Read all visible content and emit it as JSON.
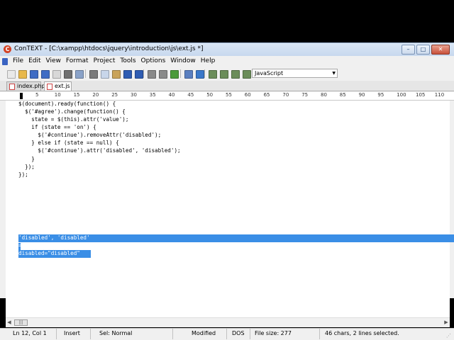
{
  "window": {
    "title": "ConTEXT - [C:\\xampp\\htdocs\\jquery\\introduction\\js\\ext.js *]",
    "controls": {
      "minimize": "–",
      "maximize": "□",
      "close": "✕"
    }
  },
  "menu": [
    "File",
    "Edit",
    "View",
    "Format",
    "Project",
    "Tools",
    "Options",
    "Window",
    "Help"
  ],
  "toolbar": {
    "language": "JavaScript",
    "buttons": [
      {
        "name": "new-icon",
        "color": "#e9e9e9"
      },
      {
        "name": "open-icon",
        "color": "#e8b84a"
      },
      {
        "name": "save-icon",
        "color": "#3f6cc4"
      },
      {
        "name": "save-all-icon",
        "color": "#3f6cc4"
      },
      {
        "name": "close-file-icon",
        "color": "#d8d8d8"
      },
      {
        "name": "print-icon",
        "color": "#707070"
      },
      {
        "name": "print-preview-icon",
        "color": "#8aa2c8"
      },
      {
        "name": "cut-icon",
        "color": "#7a7a7a"
      },
      {
        "name": "copy-icon",
        "color": "#c8d6ea"
      },
      {
        "name": "paste-icon",
        "color": "#c9a35a"
      },
      {
        "name": "undo-icon",
        "color": "#2f5db3"
      },
      {
        "name": "redo-icon",
        "color": "#2f5db3"
      },
      {
        "name": "find-icon",
        "color": "#8a8a8a"
      },
      {
        "name": "find-next-icon",
        "color": "#8a8a8a"
      },
      {
        "name": "replace-icon",
        "color": "#4a9a3a"
      },
      {
        "name": "word-wrap-icon",
        "color": "#5a7fc0"
      },
      {
        "name": "tools-icon",
        "color": "#3a78c9"
      },
      {
        "name": "execute-f9-icon",
        "color": "#6b8d5a"
      },
      {
        "name": "execute-f10-icon",
        "color": "#6b8d5a"
      },
      {
        "name": "execute-f11-icon",
        "color": "#6b8d5a"
      },
      {
        "name": "execute-f12-icon",
        "color": "#6b8d5a"
      }
    ]
  },
  "tabs": [
    {
      "label": "index.php",
      "active": false
    },
    {
      "label": "ext.js *",
      "active": true
    }
  ],
  "ruler": [
    "5",
    "10",
    "15",
    "20",
    "25",
    "30",
    "35",
    "40",
    "45",
    "50",
    "55",
    "60",
    "65",
    "70",
    "75",
    "80",
    "85",
    "90",
    "95",
    "100",
    "105",
    "110"
  ],
  "editor": {
    "lines": [
      "$(document).ready(function() {",
      "  $('#agree').change(function() {",
      "    state = $(this).attr('value');",
      "    if (state == 'on') {",
      "      $('#continue').removeAttr('disabled');",
      "    } else if (state == null) {",
      "      $('#continue').attr('disabled', 'disabled');",
      "    }",
      "  });",
      "});",
      "",
      "'disabled', 'disabled'",
      "=",
      "disabled=\"disabled\""
    ]
  },
  "status": {
    "position": "Ln 12, Col 1",
    "insert": "Insert",
    "selmode": "Sel: Normal",
    "modified": "Modified",
    "format": "DOS",
    "filesize": "File size: 277",
    "selection": "46 chars, 2 lines selected."
  }
}
